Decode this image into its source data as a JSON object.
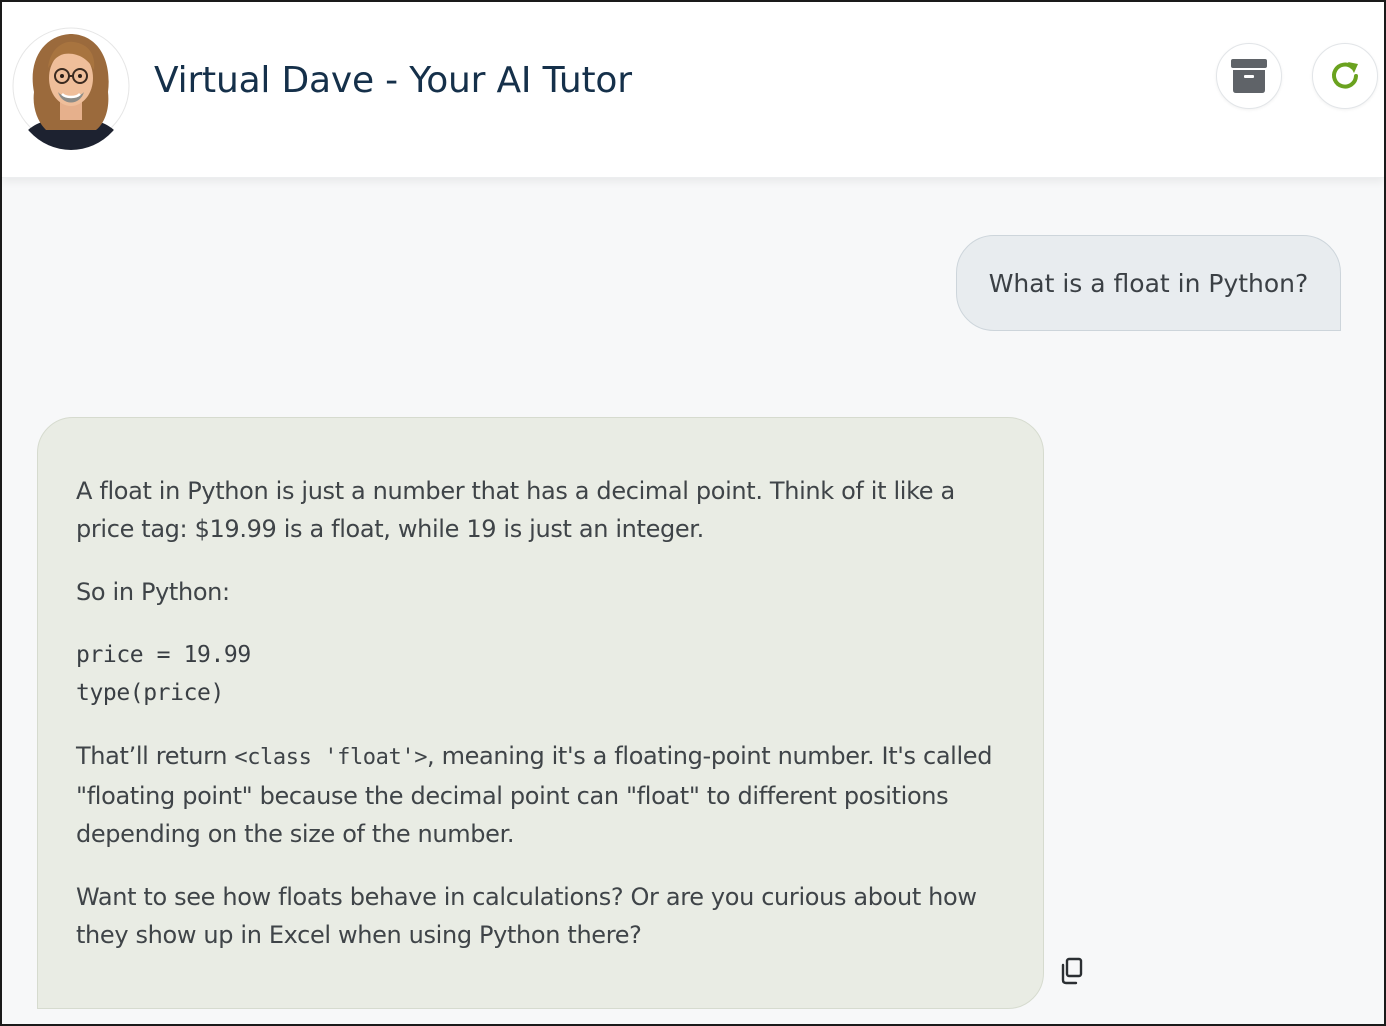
{
  "header": {
    "title": "Virtual Dave - Your AI Tutor",
    "archive_icon": "archive-box-icon",
    "refresh_icon": "refresh-icon"
  },
  "chat": {
    "user_message": "What is a float in Python?",
    "assistant": {
      "para1": "A float in Python is just a number that has a decimal point. Think of it like a price tag: $19.99 is a float, while 19 is just an integer.",
      "para2": "So in Python:",
      "code_line1": "price = 19.99",
      "code_line2": "type(price)",
      "para3_before": "That’ll return ",
      "para3_code": "<class 'float'>",
      "para3_after": ", meaning it's a floating-point number. It's called \"floating point\" because the decimal point can \"float\" to different positions depending on the size of the number.",
      "para4": "Want to see how floats behave in calculations? Or are you curious about how they show up in Excel when using Python there?"
    },
    "copy_icon": "copy-icon"
  },
  "colors": {
    "title": "#15304a",
    "archive": "#5f6368",
    "refresh": "#6aa21f",
    "user_bubble": "#e8ecef",
    "bot_bubble": "#e9ece4"
  }
}
